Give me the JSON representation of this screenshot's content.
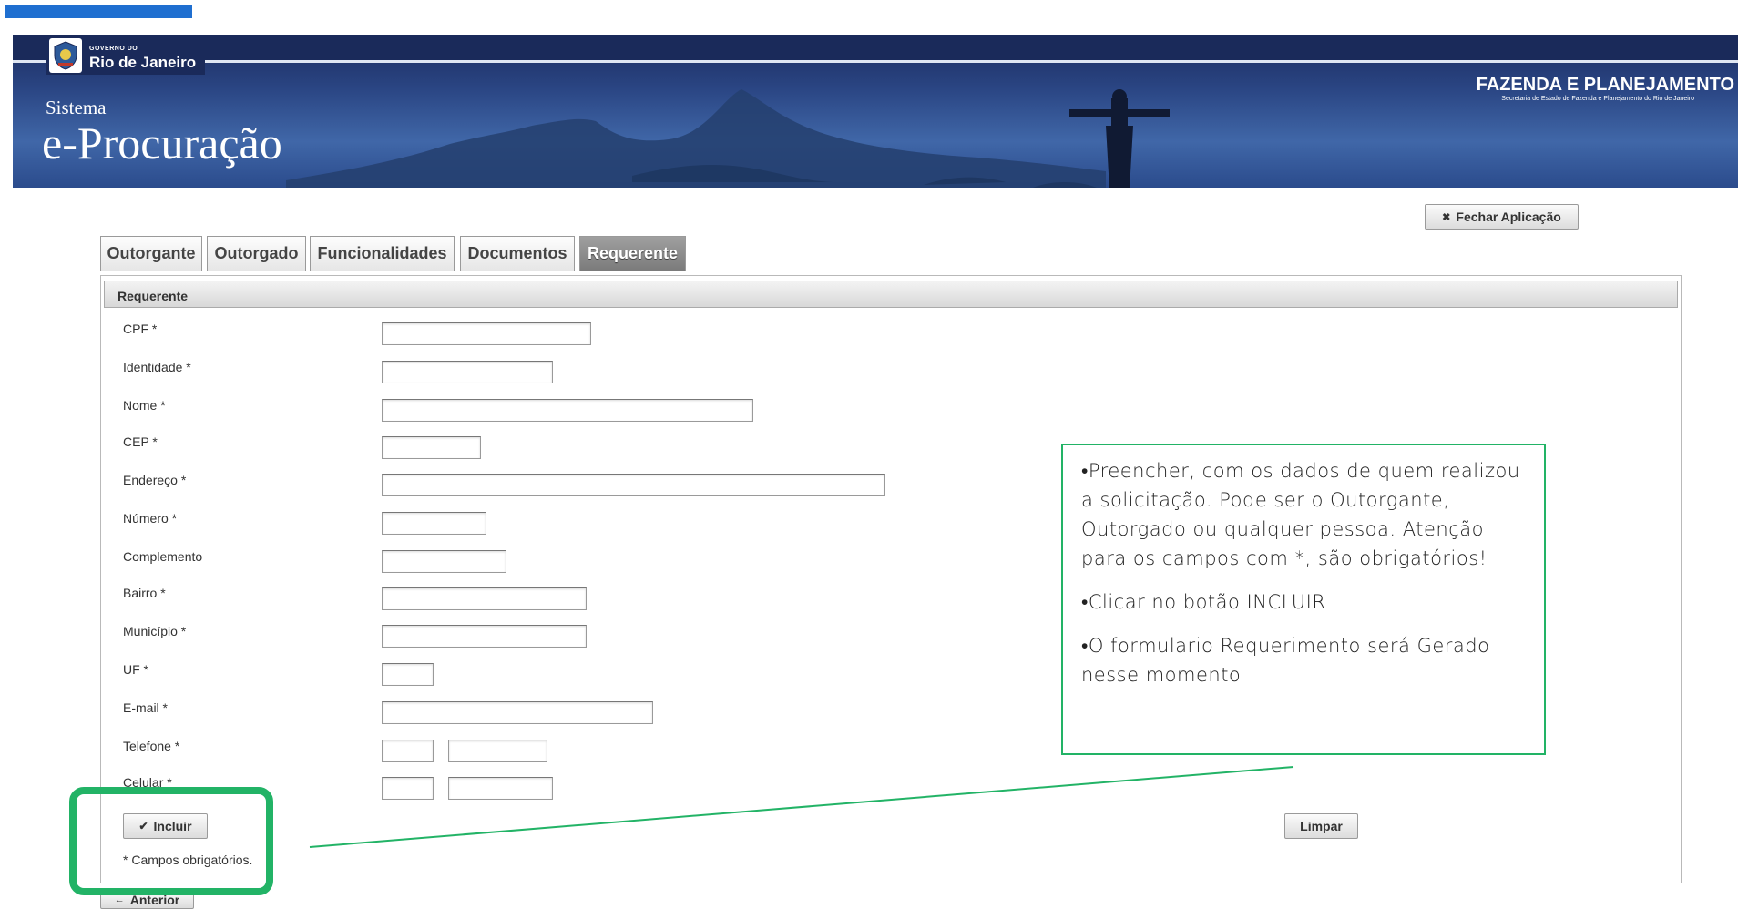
{
  "header": {
    "gov_small": "GOVERNO DO",
    "gov_name": "Rio de Janeiro",
    "sistema": "Sistema",
    "app_name": "e-Procuração",
    "dept_title": "FAZENDA E PLANEJAMENTO",
    "dept_subtitle": "Secretaria de Estado de Fazenda e Planejamento do Rio de Janeiro"
  },
  "toolbar": {
    "close_label": "Fechar Aplicação"
  },
  "tabs": [
    {
      "label": "Outorgante",
      "active": false
    },
    {
      "label": "Outorgado",
      "active": false
    },
    {
      "label": "Funcionalidades",
      "active": false
    },
    {
      "label": "Documentos",
      "active": false
    },
    {
      "label": "Requerente",
      "active": true
    }
  ],
  "panel": {
    "title": "Requerente",
    "fields": {
      "cpf": "CPF *",
      "identidade": "Identidade *",
      "nome": "Nome *",
      "cep": "CEP *",
      "endereco": "Endereço *",
      "numero": "Número *",
      "complemento": "Complemento",
      "bairro": "Bairro *",
      "municipio": "Município *",
      "uf": "UF *",
      "email": "E-mail *",
      "telefone": "Telefone *",
      "celular": "Celular *"
    },
    "include_label": "Incluir",
    "clear_label": "Limpar",
    "required_note": "* Campos obrigatórios.",
    "previous_label": "Anterior"
  },
  "annotation": {
    "bullets": [
      "•Preencher, com os dados de quem realizou a solicitação. Pode ser o Outorgante, Outorgado ou qualquer pessoa. Atenção para os campos com *, são obrigatórios!",
      "•Clicar no botão INCLUIR",
      "•O formulario Requerimento será Gerado nesse momento"
    ]
  },
  "colors": {
    "accent_blue": "#1f6fd0",
    "banner_navy": "#1b2b5e",
    "annotation_green": "#22b366"
  },
  "icons": {
    "close": "close-x-icon",
    "include": "checkmark-icon",
    "previous": "arrow-left-icon"
  }
}
